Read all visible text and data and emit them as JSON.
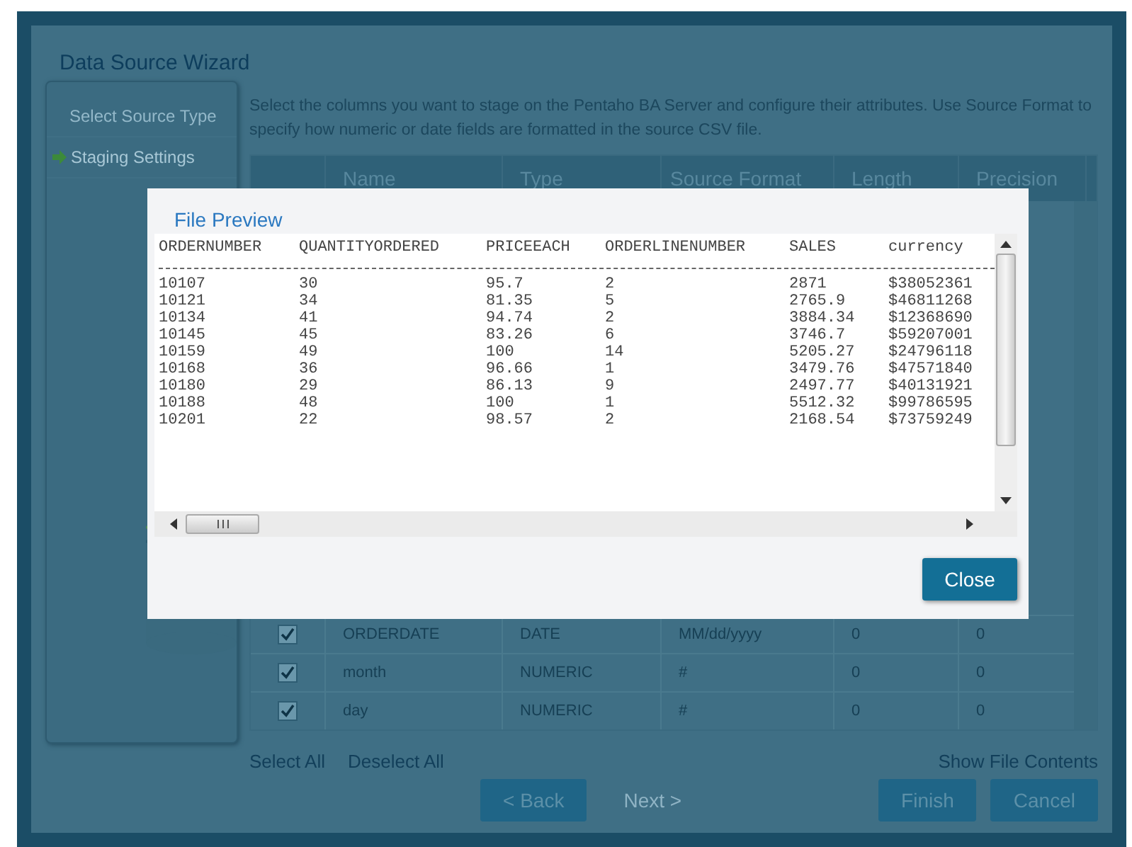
{
  "wizard": {
    "title": "Data Source Wizard",
    "steps": [
      {
        "label": "Select Source Type",
        "selected": false
      },
      {
        "label": "Staging Settings",
        "selected": true
      }
    ],
    "description": "Select the columns you want to stage on the Pentaho BA Server and configure their attributes. Use Source Format to specify how numeric or date fields are formatted in the source CSV file.",
    "table": {
      "columns": [
        "Name",
        "Type",
        "Source Format",
        "Length",
        "Precision"
      ],
      "rows": [
        {
          "checked": true,
          "name": "ORDERDATE",
          "type": "DATE",
          "source_format": "MM/dd/yyyy",
          "length": "0",
          "precision": "0"
        },
        {
          "checked": true,
          "name": "month",
          "type": "NUMERIC",
          "source_format": "#",
          "length": "0",
          "precision": "0"
        },
        {
          "checked": true,
          "name": "day",
          "type": "NUMERIC",
          "source_format": "#",
          "length": "0",
          "precision": "0"
        }
      ]
    },
    "select_all": "Select All",
    "deselect_all": "Deselect All",
    "show_file_contents": "Show File Contents",
    "buttons": [
      {
        "label": "< Back",
        "disabled": false,
        "kind": "nav"
      },
      {
        "label": "Next >",
        "disabled": true,
        "kind": "nav"
      },
      {
        "label": "Finish",
        "disabled": false,
        "kind": "end"
      },
      {
        "label": "Cancel",
        "disabled": false,
        "kind": "end"
      }
    ]
  },
  "dialog": {
    "title": "File Preview",
    "columns": [
      "ORDERNUMBER",
      "QUANTITYORDERED",
      "PRICEEACH",
      "ORDERLINENUMBER",
      "SALES",
      "currency"
    ],
    "rows": [
      [
        "10107",
        "30",
        "95.7",
        "2",
        "2871",
        "$38052361"
      ],
      [
        "10121",
        "34",
        "81.35",
        "5",
        "2765.9",
        "$46811268"
      ],
      [
        "10134",
        "41",
        "94.74",
        "2",
        "3884.34",
        "$12368690"
      ],
      [
        "10145",
        "45",
        "83.26",
        "6",
        "3746.7",
        "$59207001"
      ],
      [
        "10159",
        "49",
        "100",
        "14",
        "5205.27",
        "$24796118"
      ],
      [
        "10168",
        "36",
        "96.66",
        "1",
        "3479.76",
        "$47571840"
      ],
      [
        "10180",
        "29",
        "86.13",
        "9",
        "2497.77",
        "$40131921"
      ],
      [
        "10188",
        "48",
        "100",
        "1",
        "5512.32",
        "$99786595"
      ],
      [
        "10201",
        "22",
        "98.57",
        "2",
        "2168.54",
        "$73759249"
      ]
    ],
    "close_button": "Close"
  }
}
